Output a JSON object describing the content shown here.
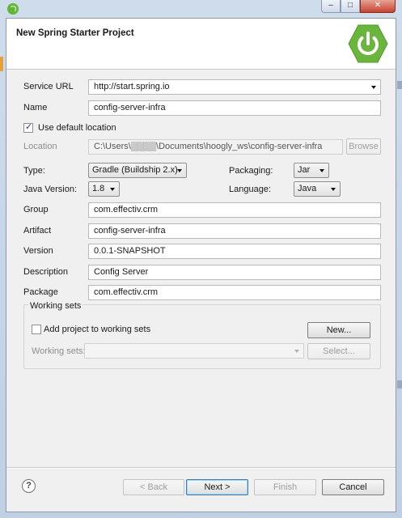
{
  "window": {
    "title_icon": "spring-leaf-icon",
    "controls": {
      "minimize": "–",
      "maximize": "□",
      "close": "✕"
    }
  },
  "header": {
    "title": "New Spring Starter Project",
    "banner_icon": "spring-power-icon",
    "banner_color": "#6ab53c"
  },
  "form": {
    "service_url": {
      "label": "Service URL",
      "value": "http://start.spring.io"
    },
    "name": {
      "label": "Name",
      "value": "config-server-infra"
    },
    "use_default_location": {
      "label": "Use default location",
      "checked": true
    },
    "location": {
      "label": "Location",
      "value": "C:\\Users\\▒▒▒▒\\Documents\\hoogly_ws\\config-server-infra",
      "browse_label": "Browse"
    },
    "type": {
      "label": "Type:",
      "value": "Gradle (Buildship 2.x)"
    },
    "packaging": {
      "label": "Packaging:",
      "value": "Jar"
    },
    "java_version": {
      "label": "Java Version:",
      "value": "1.8"
    },
    "language": {
      "label": "Language:",
      "value": "Java"
    },
    "group": {
      "label": "Group",
      "value": "com.effectiv.crm"
    },
    "artifact": {
      "label": "Artifact",
      "value": "config-server-infra"
    },
    "version": {
      "label": "Version",
      "value": "0.0.1-SNAPSHOT"
    },
    "description": {
      "label": "Description",
      "value": "Config Server"
    },
    "package": {
      "label": "Package",
      "value": "com.effectiv.crm"
    }
  },
  "working_sets": {
    "group_title": "Working sets",
    "add_label": "Add project to working sets",
    "add_checked": false,
    "new_label": "New...",
    "sets_label": "Working sets:",
    "sets_value": "",
    "select_label": "Select..."
  },
  "footer": {
    "help": "?",
    "back": "< Back",
    "next": "Next >",
    "finish": "Finish",
    "cancel": "Cancel"
  }
}
